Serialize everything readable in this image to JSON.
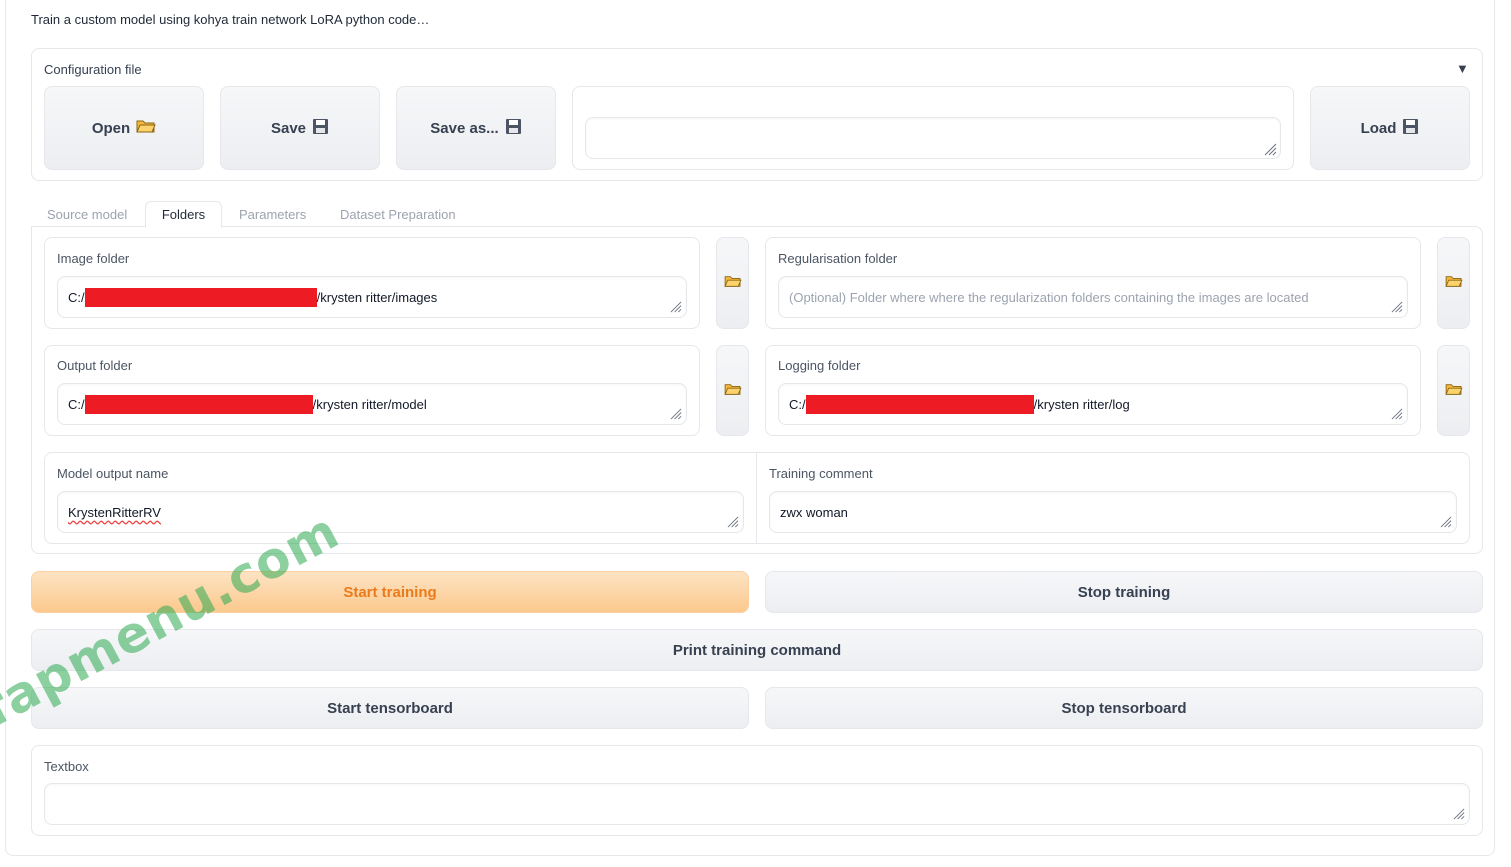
{
  "intro_text": "Train a custom model using kohya train network LoRA python code…",
  "config": {
    "title": "Configuration file",
    "collapse_glyph": "▼",
    "open_label": "Open",
    "save_label": "Save",
    "save_as_label": "Save as...",
    "load_label": "Load",
    "open_icon": "folder-icon",
    "save_icon": "floppy-disk-icon",
    "path_value": ""
  },
  "tabs": [
    {
      "label": "Source model",
      "active": false
    },
    {
      "label": "Folders",
      "active": true
    },
    {
      "label": "Parameters",
      "active": false
    },
    {
      "label": "Dataset Preparation",
      "active": false
    }
  ],
  "folders": {
    "image_folder": {
      "label": "Image folder",
      "prefix": "C:/",
      "suffix": "/krysten ritter/images"
    },
    "reg_folder": {
      "label": "Regularisation folder",
      "placeholder": "(Optional) Folder where where the regularization folders containing the images are located"
    },
    "output_folder": {
      "label": "Output folder",
      "prefix": "C:/",
      "suffix": "/krysten ritter/model"
    },
    "logging_folder": {
      "label": "Logging folder",
      "prefix": "C:/",
      "suffix": "/krysten ritter/log"
    },
    "model_output_name": {
      "label": "Model output name",
      "value": "KrystenRitterRV"
    },
    "training_comment": {
      "label": "Training comment",
      "value": "zwx woman"
    }
  },
  "actions": {
    "start_training": "Start training",
    "stop_training": "Stop training",
    "print_command": "Print training command",
    "start_tensorboard": "Start tensorboard",
    "stop_tensorboard": "Stop tensorboard"
  },
  "textbox": {
    "label": "Textbox",
    "value": ""
  },
  "watermark": "fapmenu.com",
  "colors": {
    "primary_text": "#ea7b1c",
    "primary_bg": "#fbc98d",
    "redaction": "#ed1c24"
  }
}
